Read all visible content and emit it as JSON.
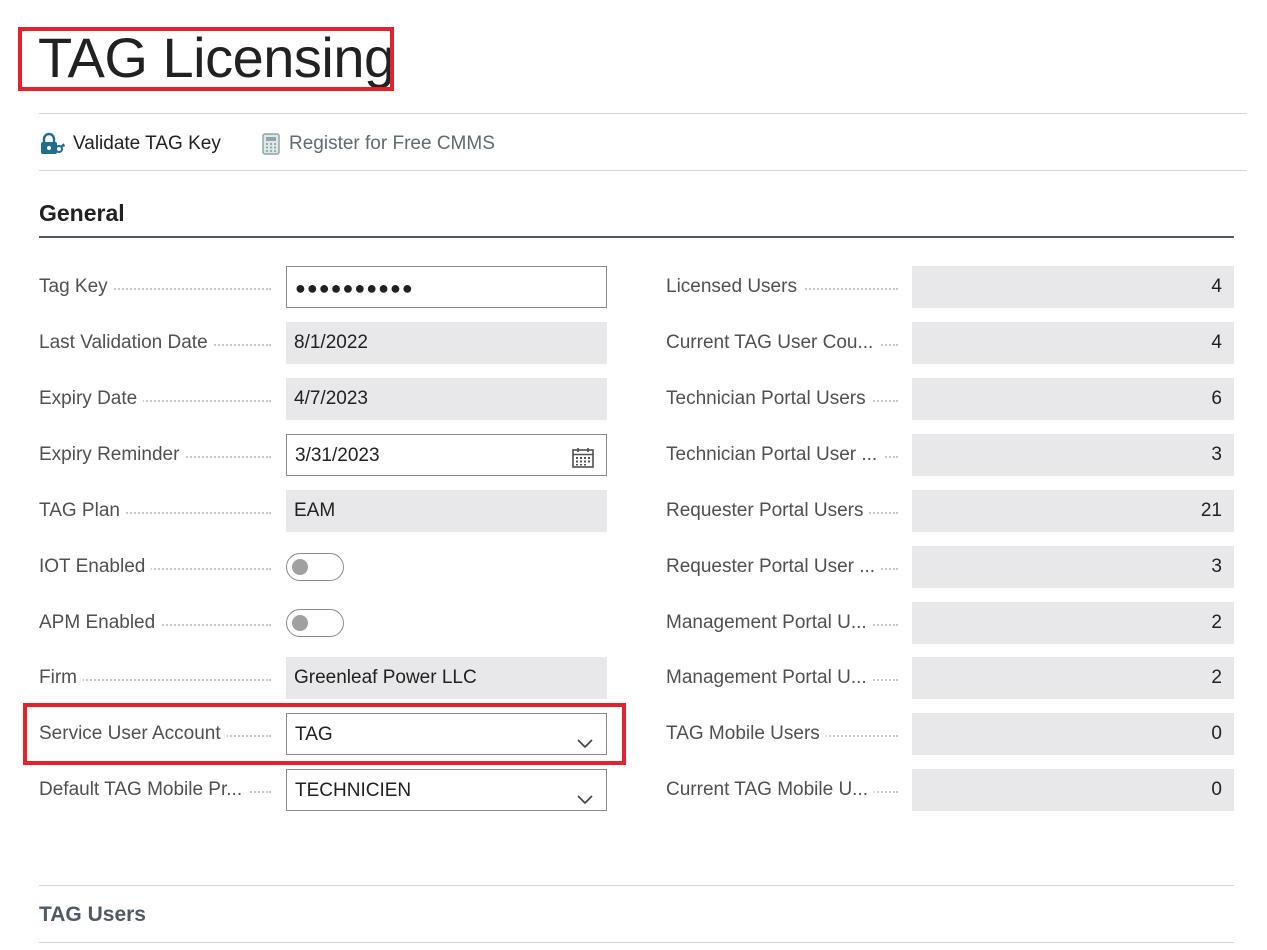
{
  "page": {
    "title": "TAG Licensing"
  },
  "actions": {
    "validate_label": "Validate TAG Key",
    "register_label": "Register for Free CMMS",
    "validate_icon": "lock-key-icon",
    "register_icon": "calculator-icon"
  },
  "general": {
    "heading": "General",
    "left_fields": [
      {
        "label": "Tag Key",
        "value": "●●●●●●●●●●",
        "kind": "password"
      },
      {
        "label": "Last Validation Date",
        "value": "8/1/2022",
        "kind": "readonly"
      },
      {
        "label": "Expiry Date",
        "value": "4/7/2023",
        "kind": "readonly"
      },
      {
        "label": "Expiry Reminder",
        "value": "3/31/2023",
        "kind": "date"
      },
      {
        "label": "TAG Plan",
        "value": "EAM",
        "kind": "readonly"
      },
      {
        "label": "IOT Enabled",
        "value": false,
        "kind": "toggle"
      },
      {
        "label": "APM Enabled",
        "value": false,
        "kind": "toggle"
      },
      {
        "label": "Firm",
        "value": "Greenleaf Power LLC",
        "kind": "readonly"
      },
      {
        "label": "Service User Account",
        "value": "TAG",
        "kind": "dropdown"
      },
      {
        "label": "Default TAG Mobile Pr...",
        "value": "TECHNICIEN",
        "kind": "dropdown"
      }
    ],
    "right_fields": [
      {
        "label": "Licensed Users",
        "value": "4"
      },
      {
        "label": "Current TAG User Cou...",
        "value": "4"
      },
      {
        "label": "Technician Portal Users",
        "value": "6"
      },
      {
        "label": "Technician Portal User ...",
        "value": "3"
      },
      {
        "label": "Requester Portal Users",
        "value": "21"
      },
      {
        "label": "Requester Portal User ...",
        "value": "3"
      },
      {
        "label": "Management Portal U...",
        "value": "2"
      },
      {
        "label": "Management Portal U...",
        "value": "2"
      },
      {
        "label": "TAG Mobile Users",
        "value": "0"
      },
      {
        "label": "Current TAG Mobile U...",
        "value": "0"
      }
    ]
  },
  "tag_users": {
    "heading": "TAG Users"
  },
  "colors": {
    "highlight": "#e3222b",
    "readonly_bg": "#e8e8ea",
    "accent": "#1f6e8c"
  }
}
